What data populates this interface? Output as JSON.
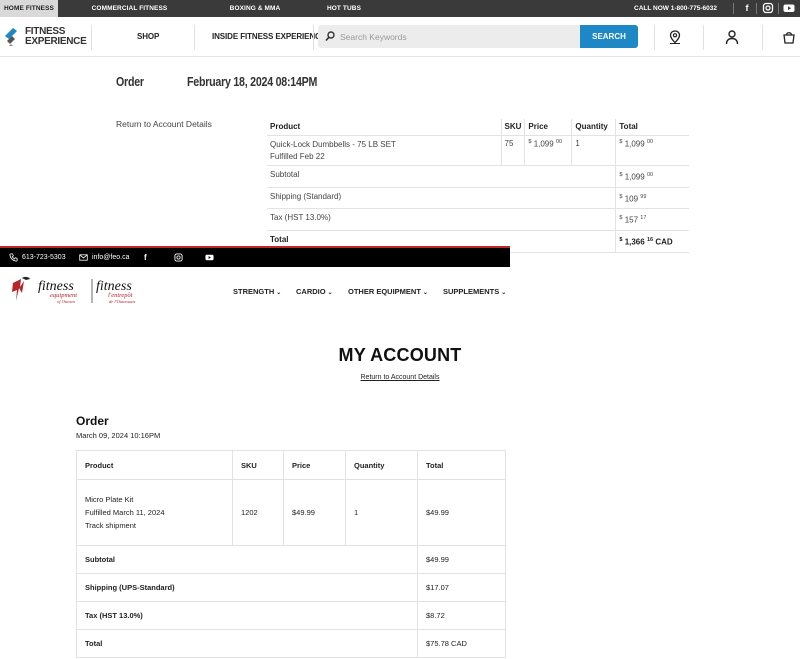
{
  "fe": {
    "topbar": {
      "tabs": [
        "HOME FITNESS",
        "COMMERCIAL FITNESS",
        "BOXING & MMA",
        "HOT TUBS"
      ],
      "call_now": "CALL NOW 1-800-775-6032"
    },
    "logo": {
      "line1": "FITNESS",
      "line2": "EXPERIENCE"
    },
    "nav": {
      "shop": "SHOP",
      "inside": "INSIDE FITNESS EXPERIENCE"
    },
    "search": {
      "placeholder": "Search Keywords",
      "button": "SEARCH"
    },
    "order": {
      "label": "Order",
      "date": "February 18, 2024 08:14PM",
      "return_link": "Return to Account Details",
      "headers": [
        "Product",
        "SKU",
        "Price",
        "Quantity",
        "Total"
      ],
      "item": {
        "name": "Quick-Lock Dumbbells - 75 LB SET",
        "fulfilled": "Fulfilled Feb 22",
        "sku": "75",
        "price_dollars": "1,099",
        "price_cents": "00",
        "quantity": "1",
        "total_dollars": "1,099",
        "total_cents": "00"
      },
      "subtotal_label": "Subtotal",
      "subtotal_dollars": "1,099",
      "subtotal_cents": "00",
      "shipping_label": "Shipping (Standard)",
      "shipping_dollars": "109",
      "shipping_cents": "99",
      "tax_label": "Tax (HST 13.0%)",
      "tax_dollars": "157",
      "tax_cents": "17",
      "total_label": "Total",
      "total_dollars": "1,366",
      "total_cents": "16",
      "total_currency": "CAD",
      "currency_symbol": "$"
    }
  },
  "feo": {
    "topbar": {
      "phone": "613-723-5303",
      "email": "info@feo.ca"
    },
    "logo": {
      "en_main": "fitness",
      "en_sub": "equipment",
      "en_city": "of Ottawa",
      "fr_main": "fitness",
      "fr_sub": "l'entrepôt",
      "fr_city": "de l'Outaouais"
    },
    "nav": [
      "STRENGTH",
      "CARDIO",
      "OTHER EQUIPMENT",
      "SUPPLEMENTS"
    ],
    "title": "MY ACCOUNT",
    "return_link": "Return to Account Details",
    "order": {
      "label": "Order",
      "date": "March 09, 2024 10:16PM",
      "headers": [
        "Product",
        "SKU",
        "Price",
        "Quantity",
        "Total"
      ],
      "item": {
        "name": "Micro Plate Kit",
        "fulfilled": "Fulfilled March 11, 2024",
        "track": "Track shipment",
        "sku": "1202",
        "price": "$49.99",
        "quantity": "1",
        "total": "$49.99"
      },
      "subtotal_label": "Subtotal",
      "subtotal": "$49.99",
      "shipping_label": "Shipping (UPS-Standard)",
      "shipping": "$17.07",
      "tax_label": "Tax (HST 13.0%)",
      "tax": "$8.72",
      "total_label": "Total",
      "total": "$75.78 CAD"
    }
  }
}
